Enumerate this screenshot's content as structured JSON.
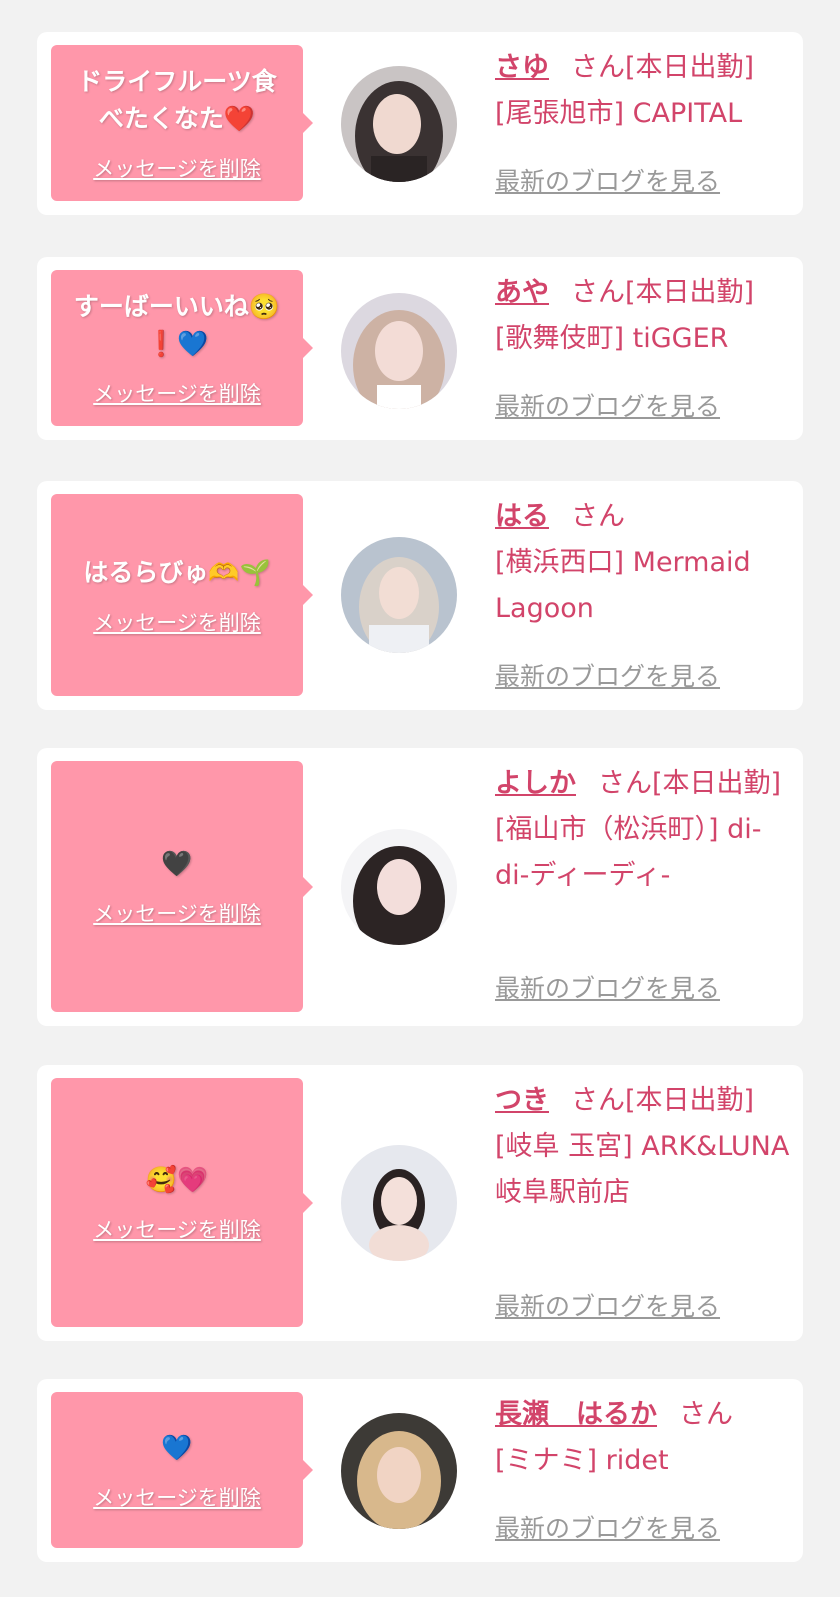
{
  "delete_label": "メッセージを削除",
  "blog_label": "最新のブログを見る",
  "entries": [
    {
      "message": "ドライフルーツ食べたくなた❤️",
      "name": "さゆ",
      "san": "さん[本日出勤]",
      "shop": "[尾張旭市] CAPITAL"
    },
    {
      "message": "すーばーいいね🥺❗💙",
      "name": "あや",
      "san": "さん[本日出勤]",
      "shop": "[歌舞伎町] tiGGER"
    },
    {
      "message": "はるらびゅ🫶🌱",
      "name": "はる",
      "san": "さん",
      "shop": "[横浜西口] Mermaid Lagoon"
    },
    {
      "message": "🖤",
      "name": "よしか",
      "san": "さん[本日出勤]",
      "shop": "[福山市（松浜町）] di-di-ディーディ-"
    },
    {
      "message": "🥰💗",
      "name": "つき",
      "san": "さん[本日出勤]",
      "shop": "[岐阜 玉宮] ARK&LUNA 岐阜駅前店"
    },
    {
      "message": "💙",
      "name": "長瀬　はるか",
      "san": "さん",
      "shop": "[ミナミ] ridet"
    }
  ],
  "colors": {
    "accent": "#d2446a",
    "bubble": "#ff97aa",
    "background": "#f2f2f2",
    "link_gray": "#999999"
  }
}
